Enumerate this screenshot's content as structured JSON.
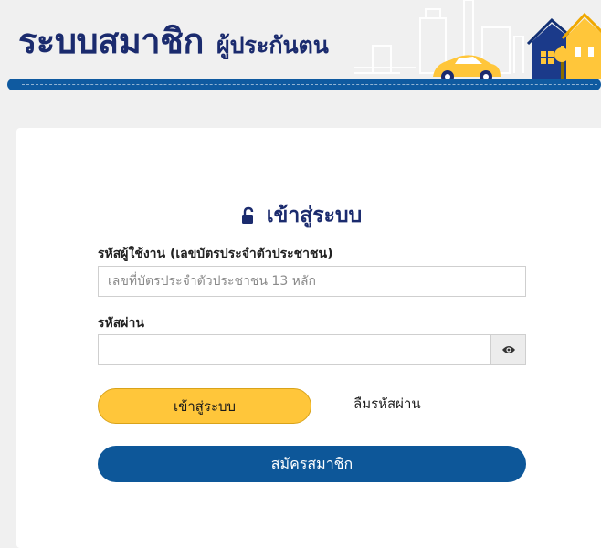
{
  "header": {
    "title_main": "ระบบสมาชิก",
    "title_sub": "ผู้ประกันตน"
  },
  "colors": {
    "brand_navy": "#1b2b6e",
    "primary_blue": "#0d5799",
    "accent_yellow": "#ffc63a",
    "background": "#f0f0f0"
  },
  "login": {
    "title": "เข้าสู่ระบบ",
    "title_icon": "unlock-icon",
    "username_label": "รหัสผู้ใช้งาน (เลขบัตรประจำตัวประชาชน)",
    "username_placeholder": "เลขที่บัตรประจำตัวประชาชน 13 หลัก",
    "username_value": "",
    "password_label": "รหัสผ่าน",
    "password_value": "",
    "toggle_icon": "eye-icon",
    "login_button": "เข้าสู่ระบบ",
    "forgot_password": "ลืมรหัสผ่าน",
    "register_button": "สมัครสมาชิก"
  }
}
